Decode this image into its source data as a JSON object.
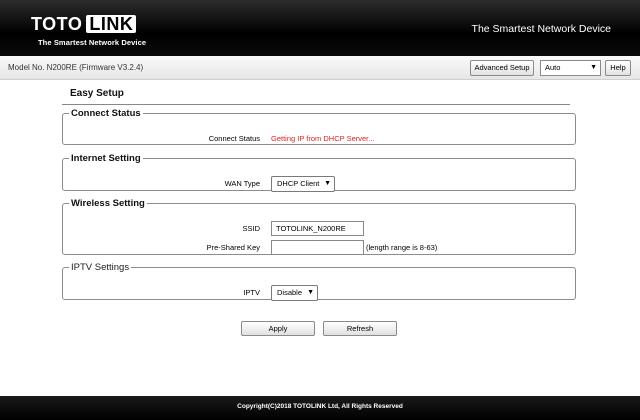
{
  "header": {
    "logo_left": "TOTO",
    "logo_right": "LINK",
    "logo_subtitle": "The Smartest Network Device",
    "tagline": "The Smartest Network Device"
  },
  "toolbar": {
    "model": "Model No. N200RE (Firmware V3.2.4)",
    "advanced_setup": "Advanced Setup",
    "language": "Auto",
    "help": "Help"
  },
  "page": {
    "title": "Easy Setup"
  },
  "connect_status": {
    "legend": "Connect Status",
    "label": "Connect Status",
    "value": "Getting IP from DHCP Server..."
  },
  "internet_setting": {
    "legend": "Internet Setting",
    "wan_label": "WAN Type",
    "wan_value": "DHCP Client"
  },
  "wireless_setting": {
    "legend": "Wireless Setting",
    "ssid_label": "SSID",
    "ssid_value": "TOTOLINK_N200RE",
    "psk_label": "Pre-Shared Key",
    "psk_value": "",
    "psk_hint": "(length range is 8-63)"
  },
  "iptv_settings": {
    "legend": "IPTV Settings",
    "iptv_label": "IPTV",
    "iptv_value": "Disable"
  },
  "actions": {
    "apply": "Apply",
    "refresh": "Refresh"
  },
  "footer": {
    "copyright": "Copyright(C)2018 TOTOLINK Ltd, All Rights Reserved"
  },
  "icons": {
    "dropdown": "chevron-down-icon"
  },
  "colors": {
    "status_text": "#e02020",
    "header_bg": "#000000"
  }
}
